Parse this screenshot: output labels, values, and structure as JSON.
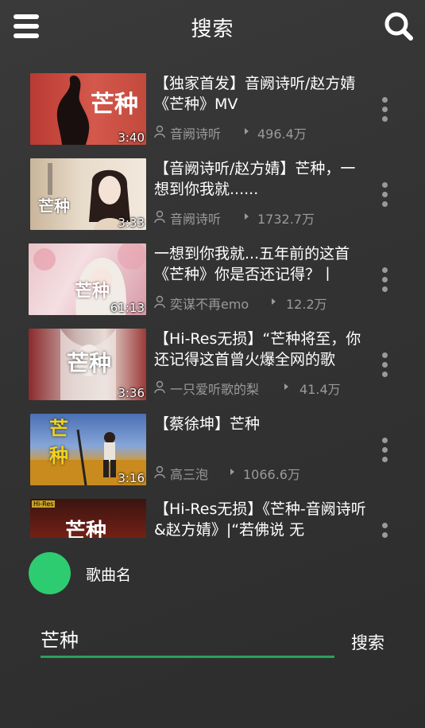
{
  "header": {
    "title": "搜索",
    "menu_icon": "menu-icon",
    "search_icon": "search-icon"
  },
  "results": [
    {
      "title": "【独家首发】音阙诗听/赵方婧《芒种》MV",
      "author": "音阙诗听",
      "views": "496.4万",
      "duration": "3:40",
      "thumb_text": "芒种"
    },
    {
      "title": "【音阙诗听/赵方婧】芒种，一想到你我就......",
      "author": "音阙诗听",
      "views": "1732.7万",
      "duration": "3:33",
      "thumb_text": "芒种"
    },
    {
      "title": "一想到你我就...五年前的这首《芒种》你是否还记得？丨",
      "author": "奕谋不再emo",
      "views": "12.2万",
      "duration": "61:13",
      "thumb_text": "芒种"
    },
    {
      "title": "【Hi-Res无损】“芒种将至，你还记得这首曾火爆全网的歌",
      "author": "一只爱听歌的梨",
      "views": "41.4万",
      "duration": "3:36",
      "thumb_text": "芒种"
    },
    {
      "title": "【蔡徐坤】芒种",
      "author": "高三泡",
      "views": "1066.6万",
      "duration": "3:16",
      "thumb_text": "芒种"
    },
    {
      "title": "【Hi-Res无损】《芒种-音阙诗听&赵方婧》|“若佛说 无",
      "author": "",
      "views": "",
      "duration": "",
      "thumb_text": "芒种"
    }
  ],
  "player": {
    "song_name": "歌曲名",
    "accent": "#2ecc71"
  },
  "search": {
    "value": "芒种",
    "submit_label": "搜索",
    "underline_color": "#2aa05b"
  }
}
